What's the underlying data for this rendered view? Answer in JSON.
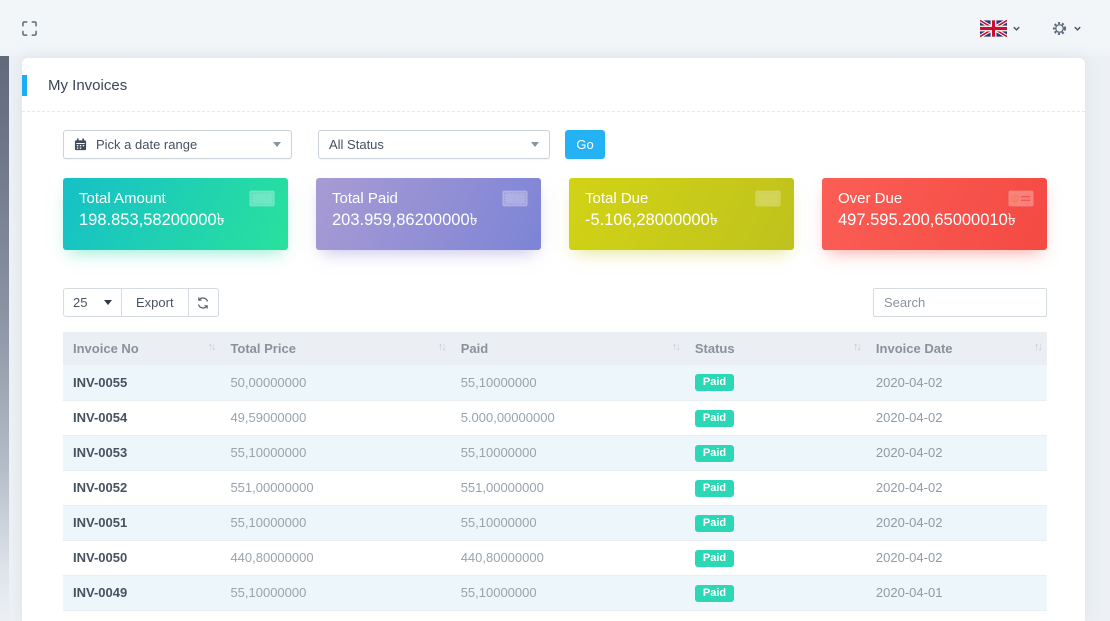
{
  "topbar": {
    "language": {
      "flag": "uk-flag"
    },
    "settings": {
      "icon": "gear-icon"
    }
  },
  "page": {
    "title": "My Invoices"
  },
  "filters": {
    "date_range_placeholder": "Pick a date range",
    "status_selected": "All Status",
    "go_label": "Go"
  },
  "summary_cards": [
    {
      "label": "Total Amount",
      "value": "198.853,58200000৳",
      "icon": "banknote-icon",
      "color_from": "#16c0c7",
      "color_to": "#2ae19d"
    },
    {
      "label": "Total Paid",
      "value": "203.959,86200000৳",
      "icon": "banknote-icon",
      "color_from": "#a89bd4",
      "color_to": "#7d84d6"
    },
    {
      "label": "Total Due",
      "value": "-5.106,28000000৳",
      "icon": "banknote-icon",
      "color_from": "#d2d315",
      "color_to": "#bfc21d"
    },
    {
      "label": "Over Due",
      "value": "497.595.200,65000010৳",
      "icon": "money-check-icon",
      "color_from": "#fb5e55",
      "color_to": "#f44a43"
    }
  ],
  "table_controls": {
    "page_size": "25",
    "export_label": "Export",
    "refresh_icon": "refresh-icon",
    "search_placeholder": "Search"
  },
  "table": {
    "columns": [
      "Invoice No",
      "Total Price",
      "Paid",
      "Status",
      "Invoice Date"
    ],
    "status_badge_color": "#2bd7b4",
    "rows": [
      {
        "invoice_no": "INV-0055",
        "total_price": "50,00000000",
        "paid": "55,10000000",
        "status": "Paid",
        "invoice_date": "2020-04-02"
      },
      {
        "invoice_no": "INV-0054",
        "total_price": "49,59000000",
        "paid": "5.000,00000000",
        "status": "Paid",
        "invoice_date": "2020-04-02"
      },
      {
        "invoice_no": "INV-0053",
        "total_price": "55,10000000",
        "paid": "55,10000000",
        "status": "Paid",
        "invoice_date": "2020-04-02"
      },
      {
        "invoice_no": "INV-0052",
        "total_price": "551,00000000",
        "paid": "551,00000000",
        "status": "Paid",
        "invoice_date": "2020-04-02"
      },
      {
        "invoice_no": "INV-0051",
        "total_price": "55,10000000",
        "paid": "55,10000000",
        "status": "Paid",
        "invoice_date": "2020-04-02"
      },
      {
        "invoice_no": "INV-0050",
        "total_price": "440,80000000",
        "paid": "440,80000000",
        "status": "Paid",
        "invoice_date": "2020-04-02"
      },
      {
        "invoice_no": "INV-0049",
        "total_price": "55,10000000",
        "paid": "55,10000000",
        "status": "Paid",
        "invoice_date": "2020-04-01"
      }
    ]
  },
  "colors": {
    "accent_blue": "#1badf2",
    "go_button": "#25b2f5"
  }
}
